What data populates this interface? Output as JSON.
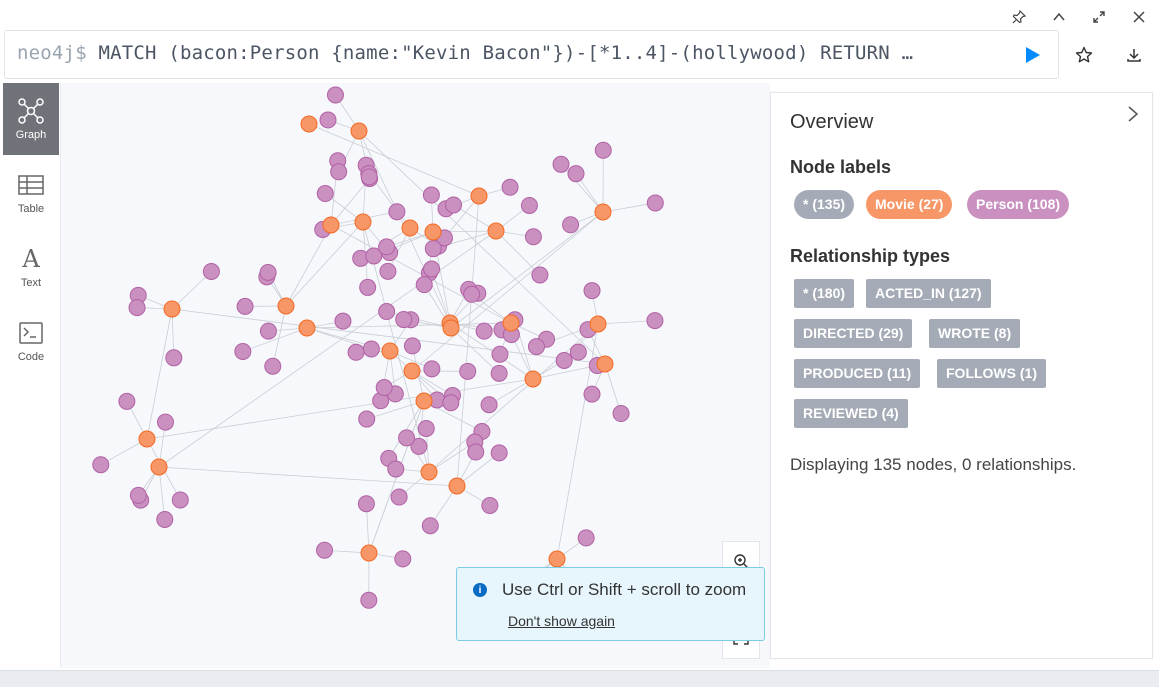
{
  "window": {
    "pin_icon": "pin-icon",
    "collapse_icon": "chevron-up-icon",
    "fullscreen_icon": "expand-icon",
    "close_icon": "close-icon"
  },
  "editor": {
    "prompt": "neo4j$",
    "query": " MATCH (bacon:Person {name:\"Kevin Bacon\"})-[*1..4]-(hollywood) RETURN …",
    "run_icon": "play-icon",
    "run_color": "#018bff"
  },
  "actions": {
    "favorite_icon": "star-icon",
    "download_icon": "download-icon"
  },
  "views": [
    {
      "label": "Graph",
      "icon": "graph-icon",
      "active": true
    },
    {
      "label": "Table",
      "icon": "table-icon",
      "active": false
    },
    {
      "label": "Text",
      "icon": "text-icon",
      "active": false
    },
    {
      "label": "Code",
      "icon": "code-icon",
      "active": false
    }
  ],
  "colors": {
    "movie": "#f79767",
    "person": "#c990c0",
    "all": "#a5abb6",
    "movie_stroke": "#f36924",
    "person_stroke": "#b261a5"
  },
  "toast": {
    "message": "Use Ctrl or Shift + scroll to zoom",
    "link": "Don't show again",
    "icon": "info-icon"
  },
  "zoom": {
    "zoom_in_icon": "zoom-in-icon",
    "zoom_out_icon": "zoom-out-icon",
    "fit_icon": "fit-icon"
  },
  "overview": {
    "title": "Overview",
    "node_labels_heading": "Node labels",
    "node_labels": [
      "* (135)",
      "Movie (27)",
      "Person (108)"
    ],
    "relationship_types_heading": "Relationship types",
    "relationship_types": [
      "* (180)",
      "ACTED_IN (127)",
      "DIRECTED (29)",
      "WROTE (8)",
      "PRODUCED (11)",
      "FOLLOWS (1)",
      "REVIEWED (4)"
    ],
    "status": "Displaying 135 nodes, 0 relationships."
  }
}
